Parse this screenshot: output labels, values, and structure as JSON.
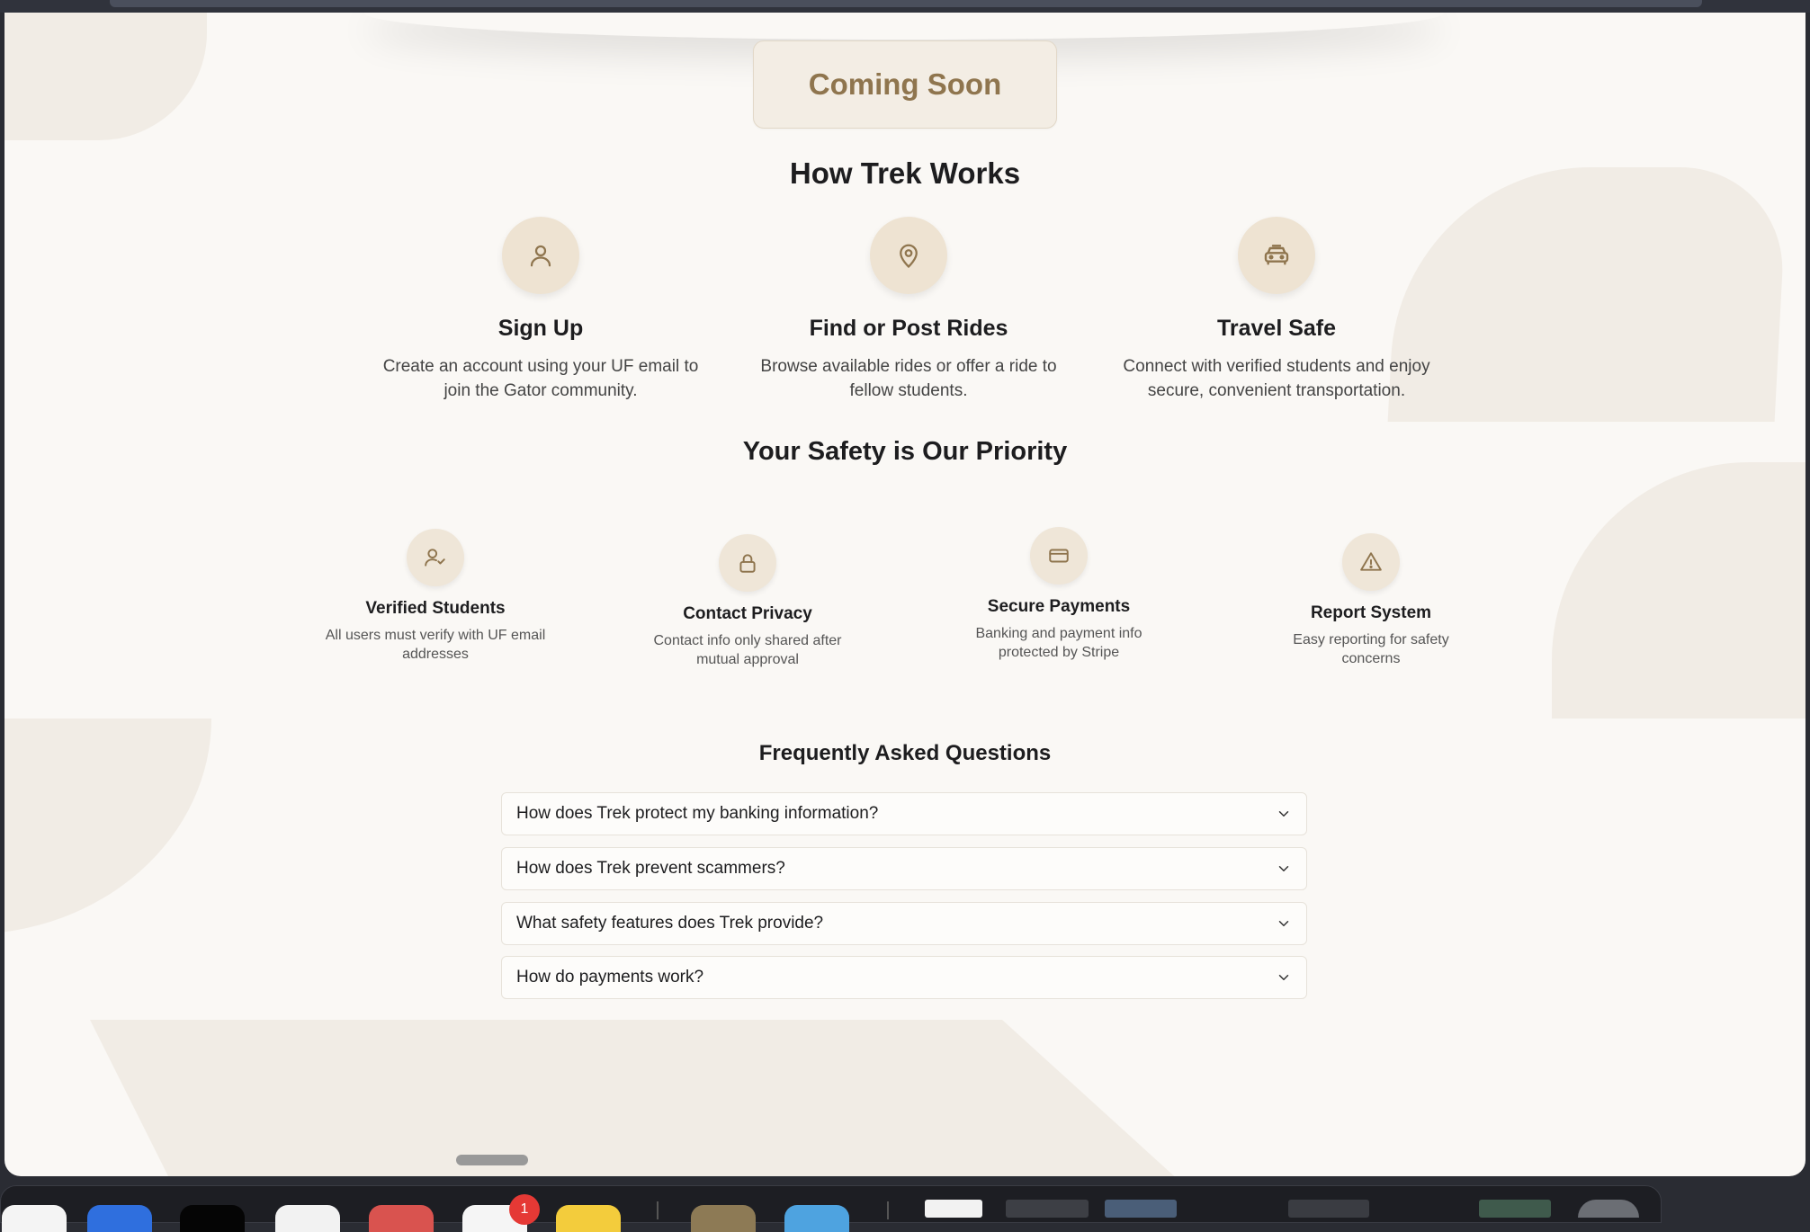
{
  "hero": {
    "badge": "Coming Soon"
  },
  "how_it_works": {
    "title": "How Trek Works",
    "steps": [
      {
        "icon": "user-icon",
        "title": "Sign Up",
        "line1": "Create an account using your UF email to",
        "line2": "join the Gator community."
      },
      {
        "icon": "map-pin-icon",
        "title": "Find or Post Rides",
        "line1": "Browse available rides or offer a ride to",
        "line2": "fellow students."
      },
      {
        "icon": "car-icon",
        "title": "Travel Safe",
        "line1": "Connect with verified students and enjoy",
        "line2": "secure, convenient transportation."
      }
    ]
  },
  "safety": {
    "title": "Your Safety is Our Priority",
    "features": [
      {
        "icon": "user-check-icon",
        "title": "Verified Students",
        "line1": "All users must verify with UF email",
        "line2": "addresses"
      },
      {
        "icon": "lock-icon",
        "title": "Contact Privacy",
        "line1": "Contact info only shared after",
        "line2": "mutual approval"
      },
      {
        "icon": "credit-card-icon",
        "title": "Secure Payments",
        "line1": "Banking and payment info",
        "line2": "protected by Stripe"
      },
      {
        "icon": "alert-triangle-icon",
        "title": "Report System",
        "line1": "Easy reporting for safety",
        "line2": "concerns"
      }
    ]
  },
  "faq": {
    "title": "Frequently Asked Questions",
    "items": [
      "How does Trek protect my banking information?",
      "How does Trek prevent scammers?",
      "What safety features does Trek provide?",
      "How do payments work?"
    ]
  },
  "dock": {
    "badge_count": "1"
  },
  "colors": {
    "accent": "#8f754e",
    "icon_bg": "#eee3d2",
    "page_bg": "#faf8f5"
  }
}
